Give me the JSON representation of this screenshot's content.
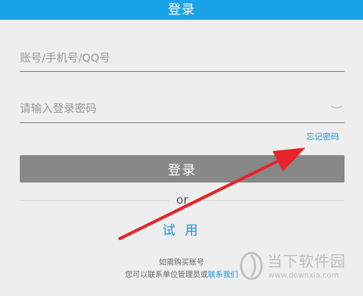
{
  "header": {
    "title": "登录"
  },
  "form": {
    "account_placeholder": "账号/手机号/QQ号",
    "password_placeholder": "请输入登录密码",
    "forgot_password": "忘记密码",
    "login_button": "登录"
  },
  "divider": {
    "or_text": "or"
  },
  "trial": {
    "label": "试 用"
  },
  "purchase": {
    "line1": "如需购买账号",
    "line2_prefix": "您可以联系单位管理员或",
    "line2_link": "联系我们"
  },
  "watermark": {
    "title": "当下软件园",
    "url": "www.downxia.com"
  },
  "colors": {
    "header_blue": "#1aa3e8",
    "link_blue": "#1a97e0",
    "button_gray": "#888888",
    "annotation_red": "#e8232a"
  }
}
